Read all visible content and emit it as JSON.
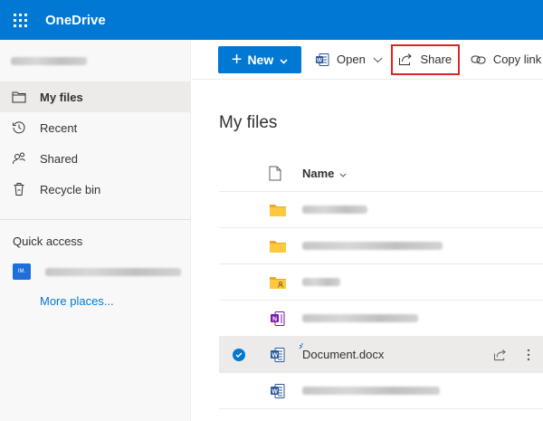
{
  "app": {
    "name": "OneDrive"
  },
  "colors": {
    "brand": "#0078d4",
    "highlight_border": "#d9262b",
    "selected_row": "#edebe9"
  },
  "sidebar": {
    "items": [
      {
        "label": "My files",
        "icon": "folder-icon",
        "selected": true
      },
      {
        "label": "Recent",
        "icon": "clock-history-icon",
        "selected": false
      },
      {
        "label": "Shared",
        "icon": "people-icon",
        "selected": false
      },
      {
        "label": "Recycle bin",
        "icon": "recycle-bin-icon",
        "selected": false
      }
    ],
    "quick_access_title": "Quick access",
    "more_places": "More places..."
  },
  "toolbar": {
    "new_label": "New",
    "open_label": "Open",
    "share_label": "Share",
    "copy_link_label": "Copy link"
  },
  "main": {
    "title": "My files",
    "name_column": "Name",
    "rows": [
      {
        "type": "folder",
        "name_visible": false,
        "selected": false
      },
      {
        "type": "folder",
        "name_visible": false,
        "selected": false
      },
      {
        "type": "shared-folder",
        "name_visible": false,
        "selected": false
      },
      {
        "type": "onenote",
        "name_visible": false,
        "selected": false
      },
      {
        "type": "word",
        "name": "Document.docx",
        "name_visible": true,
        "selected": true
      },
      {
        "type": "word",
        "name_visible": false,
        "selected": false
      }
    ]
  }
}
